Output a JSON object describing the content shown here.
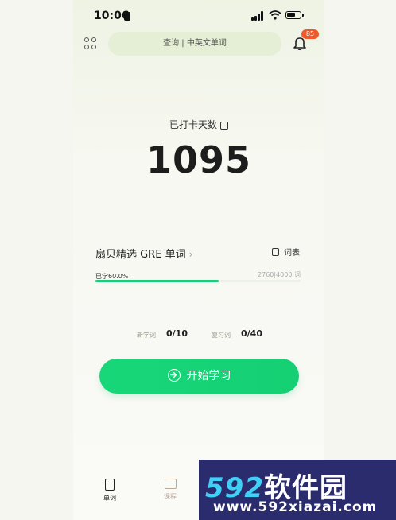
{
  "status_bar": {
    "time": "10:06"
  },
  "header": {
    "search_placeholder": "查询 | 中英文单词",
    "notification_count": "85"
  },
  "checkin": {
    "label": "已打卡天数",
    "count": "1095"
  },
  "book": {
    "title": "扇贝精选 GRE 单词",
    "wordlist_label": "词表",
    "progress_label": "已学60.0%",
    "progress_fraction": 0.6,
    "progress_count": "2760|4000 词"
  },
  "stats": {
    "new_label": "新学词",
    "new_value": "0/10",
    "review_label": "复习词",
    "review_value": "0/40"
  },
  "start_button": {
    "label": "开始学习"
  },
  "tabs": [
    {
      "label": "单词",
      "active": true
    },
    {
      "label": "课程",
      "active": false
    }
  ],
  "watermark": {
    "brand_num": "592",
    "brand_text": "软件园",
    "domain": "www.592xiazai.com"
  },
  "colors": {
    "accent": "#17d779",
    "badge": "#f05a2a",
    "search_bg": "#e4efd5"
  }
}
